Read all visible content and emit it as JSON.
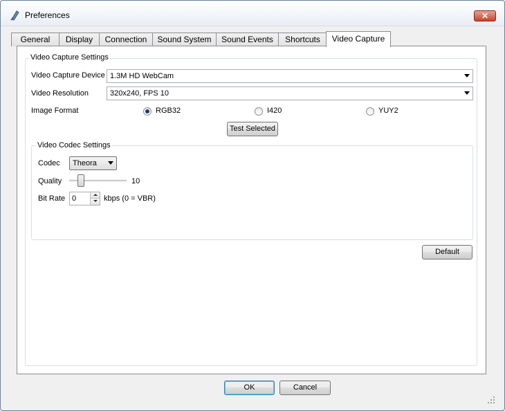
{
  "window": {
    "title": "Preferences",
    "close_label": "✕"
  },
  "tabs": [
    {
      "label": "General"
    },
    {
      "label": "Display"
    },
    {
      "label": "Connection"
    },
    {
      "label": "Sound System"
    },
    {
      "label": "Sound Events"
    },
    {
      "label": "Shortcuts"
    },
    {
      "label": "Video Capture",
      "active": true
    }
  ],
  "capture": {
    "group_title": "Video Capture Settings",
    "device_label": "Video Capture Device",
    "device_value": "1.3M HD WebCam",
    "resolution_label": "Video Resolution",
    "resolution_value": "320x240, FPS 10",
    "format_label": "Image Format",
    "formats": [
      {
        "label": "RGB32",
        "selected": true
      },
      {
        "label": "I420",
        "selected": false
      },
      {
        "label": "YUY2",
        "selected": false
      }
    ],
    "test_button": "Test Selected"
  },
  "codec": {
    "group_title": "Video Codec Settings",
    "codec_label": "Codec",
    "codec_value": "Theora",
    "quality_label": "Quality",
    "quality_value": "10",
    "bitrate_label": "Bit Rate",
    "bitrate_value": "0",
    "bitrate_unit": "kbps (0 = VBR)"
  },
  "default_button": "Default",
  "ok_button": "OK",
  "cancel_button": "Cancel",
  "colors": {
    "selected_radio": "#1a3e6e",
    "default_button_border": "#3c7fb1"
  }
}
